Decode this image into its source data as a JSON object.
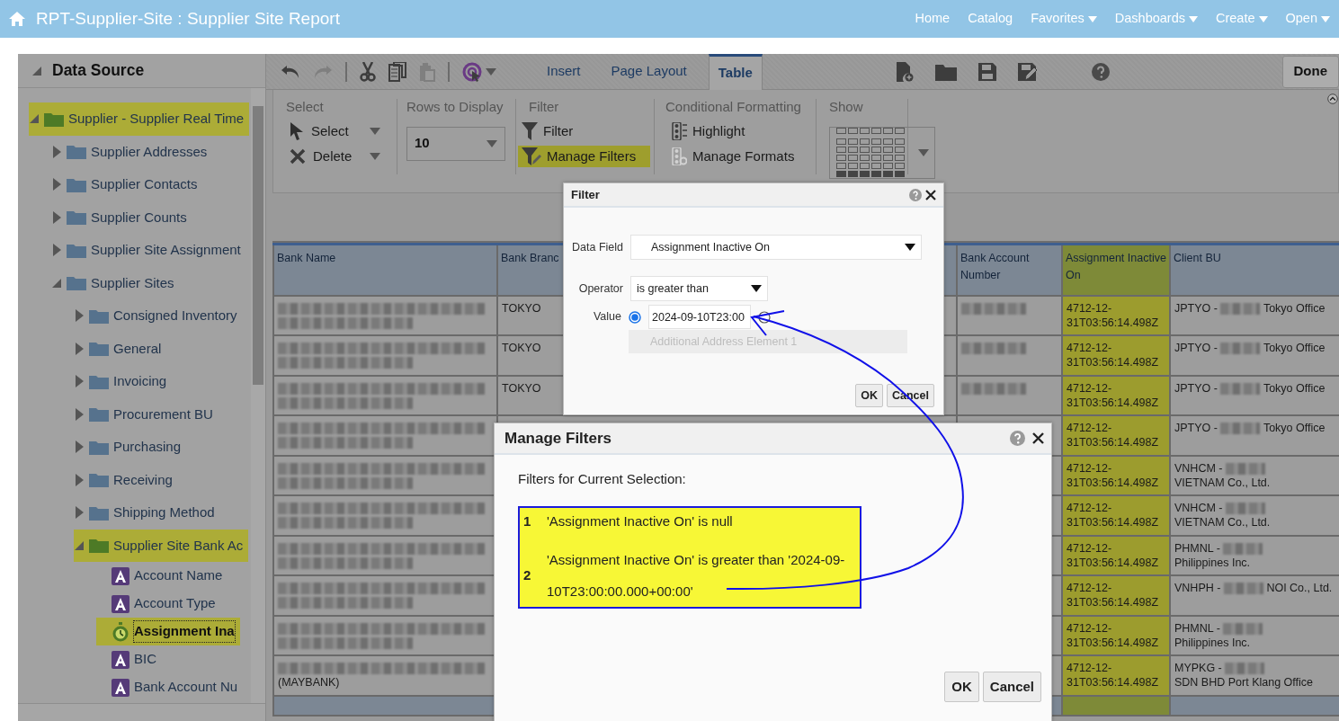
{
  "header": {
    "title": "RPT-Supplier-Site : Supplier Site Report",
    "nav": [
      {
        "label": "Home",
        "menu": false
      },
      {
        "label": "Catalog",
        "menu": false
      },
      {
        "label": "Favorites",
        "menu": true
      },
      {
        "label": "Dashboards",
        "menu": true
      },
      {
        "label": "Create",
        "menu": true
      },
      {
        "label": "Open",
        "menu": true
      }
    ]
  },
  "data_source": {
    "title": "Data Source",
    "tree": [
      {
        "label": "Supplier - Supplier Real Time",
        "kind": "folder",
        "expanded": true,
        "selected": true,
        "children": [
          {
            "label": "Supplier Addresses",
            "kind": "folder",
            "expanded": false,
            "selected": false
          },
          {
            "label": "Supplier Contacts",
            "kind": "folder",
            "expanded": false,
            "selected": false
          },
          {
            "label": "Supplier Counts",
            "kind": "folder",
            "expanded": false,
            "selected": false
          },
          {
            "label": "Supplier Site Assignment",
            "kind": "folder",
            "expanded": false,
            "selected": false
          },
          {
            "label": "Supplier Sites",
            "kind": "folder",
            "expanded": true,
            "selected": false,
            "children": [
              {
                "label": "Consigned Inventory",
                "kind": "folder",
                "expanded": false,
                "selected": false
              },
              {
                "label": "General",
                "kind": "folder",
                "expanded": false,
                "selected": false
              },
              {
                "label": "Invoicing",
                "kind": "folder",
                "expanded": false,
                "selected": false
              },
              {
                "label": "Procurement BU",
                "kind": "folder",
                "expanded": false,
                "selected": false
              },
              {
                "label": "Purchasing",
                "kind": "folder",
                "expanded": false,
                "selected": false
              },
              {
                "label": "Receiving",
                "kind": "folder",
                "expanded": false,
                "selected": false
              },
              {
                "label": "Shipping Method",
                "kind": "folder",
                "expanded": false,
                "selected": false
              },
              {
                "label": "Supplier Site Bank Ac",
                "kind": "folder",
                "expanded": true,
                "selected": true,
                "children": [
                  {
                    "label": "Account Name",
                    "kind": "attribute",
                    "selected": false
                  },
                  {
                    "label": "Account Type",
                    "kind": "attribute",
                    "selected": false
                  },
                  {
                    "label": "Assignment Ina",
                    "kind": "date",
                    "selected": true
                  },
                  {
                    "label": "BIC",
                    "kind": "attribute",
                    "selected": false
                  },
                  {
                    "label": "Bank Account Nu",
                    "kind": "attribute",
                    "selected": false
                  }
                ]
              }
            ]
          }
        ]
      }
    ]
  },
  "toolbar": {
    "tools": [
      {
        "kind": "undo",
        "disabled": false
      },
      {
        "kind": "redo",
        "disabled": true
      },
      {
        "kind": "cut",
        "disabled": false
      },
      {
        "kind": "copy",
        "disabled": false
      },
      {
        "kind": "paste",
        "disabled": true
      },
      {
        "kind": "target",
        "disabled": false
      }
    ],
    "tabs": [
      {
        "label": "Insert",
        "selected": false
      },
      {
        "label": "Page Layout",
        "selected": false
      },
      {
        "label": "Table",
        "selected": true
      }
    ],
    "done_button": "Done"
  },
  "ribbon": {
    "select": {
      "title": "Select",
      "items": [
        {
          "label": "Select"
        },
        {
          "label": "Delete"
        }
      ]
    },
    "rows": {
      "title": "Rows to Display",
      "value": "10"
    },
    "filter": {
      "title": "Filter",
      "items": [
        {
          "label": "Filter",
          "highlighted": false
        },
        {
          "label": "Manage Filters",
          "highlighted": true
        }
      ]
    },
    "formatting": {
      "title": "Conditional Formatting",
      "items": [
        {
          "label": "Highlight",
          "disabled": false
        },
        {
          "label": "Manage Formats",
          "disabled": true
        }
      ]
    },
    "show": {
      "title": "Show"
    }
  },
  "table": {
    "columns": [
      {
        "label": "Bank Name",
        "highlighted": false
      },
      {
        "label": "Bank Branc",
        "highlighted": false
      },
      {
        "label": "Bank Account Number",
        "highlighted": false
      },
      {
        "label": "Assignment Inactive On",
        "highlighted": true
      },
      {
        "label": "Client BU",
        "highlighted": false
      }
    ],
    "rows": [
      {
        "branch": "TOKYO",
        "account_blurred": true,
        "inactive_on": "4712-12-31T03:56:14.498Z",
        "client_code": "JPTYO -",
        "client_name": "Tokyo Office"
      },
      {
        "branch": "TOKYO",
        "account_blurred": true,
        "inactive_on": "4712-12-31T03:56:14.498Z",
        "client_code": "JPTYO -",
        "client_name": "Tokyo Office"
      },
      {
        "branch": "TOKYO",
        "account_blurred": true,
        "inactive_on": "4712-12-31T03:56:14.498Z",
        "client_code": "JPTYO -",
        "client_name": "Tokyo Office"
      },
      {
        "inactive_on": "4712-12-31T03:56:14.498Z",
        "client_code": "JPTYO -",
        "client_name": "Tokyo Office"
      },
      {
        "inactive_on": "4712-12-31T03:56:14.498Z",
        "client_code": "VNHCM -",
        "client_name": "VIETNAM Co., Ltd."
      },
      {
        "inactive_on": "4712-12-31T03:56:14.498Z",
        "client_code": "VNHCM -",
        "client_name": "VIETNAM Co., Ltd."
      },
      {
        "inactive_on": "4712-12-31T03:56:14.498Z",
        "client_code": "PHMNL -",
        "client_name": "Philippines Inc."
      },
      {
        "inactive_on": "4712-12-31T03:56:14.498Z",
        "client_code": "VNHPH -",
        "client_name": "NOI Co., Ltd."
      },
      {
        "inactive_on": "4712-12-31T03:56:14.498Z",
        "client_code": "PHMNL -",
        "client_name": "Philippines Inc."
      },
      {
        "bank_note": "(MAYBANK)",
        "inactive_on": "4712-12-31T03:56:14.498Z",
        "client_code": "MYPKG -",
        "client_name": "SDN BHD Port Klang Office"
      }
    ]
  },
  "filter_dialog": {
    "title": "Filter",
    "data_field_label": "Data Field",
    "data_field": "Assignment Inactive On",
    "operator_label": "Operator",
    "operator": "is greater than",
    "value_label": "Value",
    "value": "2024-09-10T23:00",
    "value_radios": [
      {
        "selected": true
      },
      {
        "selected": false
      }
    ],
    "extra_placeholder": "Additional Address Element 1",
    "buttons": [
      "OK",
      "Cancel"
    ]
  },
  "manage_filters": {
    "title": "Manage Filters",
    "subtitle": "Filters for Current Selection:",
    "filters": [
      {
        "number": "1",
        "text": "'Assignment Inactive On' is null"
      },
      {
        "number": "2",
        "text": "'Assignment Inactive On' is greater than '2024-09-10T23:00:00.000+00:00'"
      }
    ],
    "buttons": [
      "OK",
      "Cancel"
    ]
  }
}
